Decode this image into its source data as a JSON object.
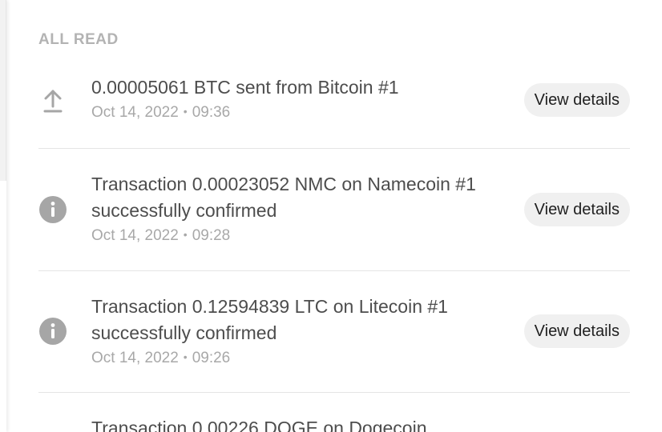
{
  "section": {
    "title": "ALL READ"
  },
  "notifications": [
    {
      "icon": "upload-arrow-icon",
      "message": "0.00005061 BTC sent from Bitcoin #1",
      "date": "Oct 14, 2022",
      "separator": "•",
      "time": "09:36",
      "action_label": "View details"
    },
    {
      "icon": "info-circle-icon",
      "message": "Transaction 0.00023052 NMC on Namecoin #1 successfully confirmed",
      "date": "Oct 14, 2022",
      "separator": "•",
      "time": "09:28",
      "action_label": "View details"
    },
    {
      "icon": "info-circle-icon",
      "message": "Transaction 0.12594839 LTC on Litecoin #1 successfully confirmed",
      "date": "Oct 14, 2022",
      "separator": "•",
      "time": "09:26",
      "action_label": "View details"
    },
    {
      "message": "Transaction 0.00226 DOGE on Dogecoin"
    }
  ],
  "colors": {
    "section_title": "#b3b3b3",
    "message_text": "#4d4d4d",
    "meta_text": "#a8a8a8",
    "icon": "#a6a6a6",
    "button_bg": "#f0f0f0",
    "divider": "#e4e4e4"
  }
}
